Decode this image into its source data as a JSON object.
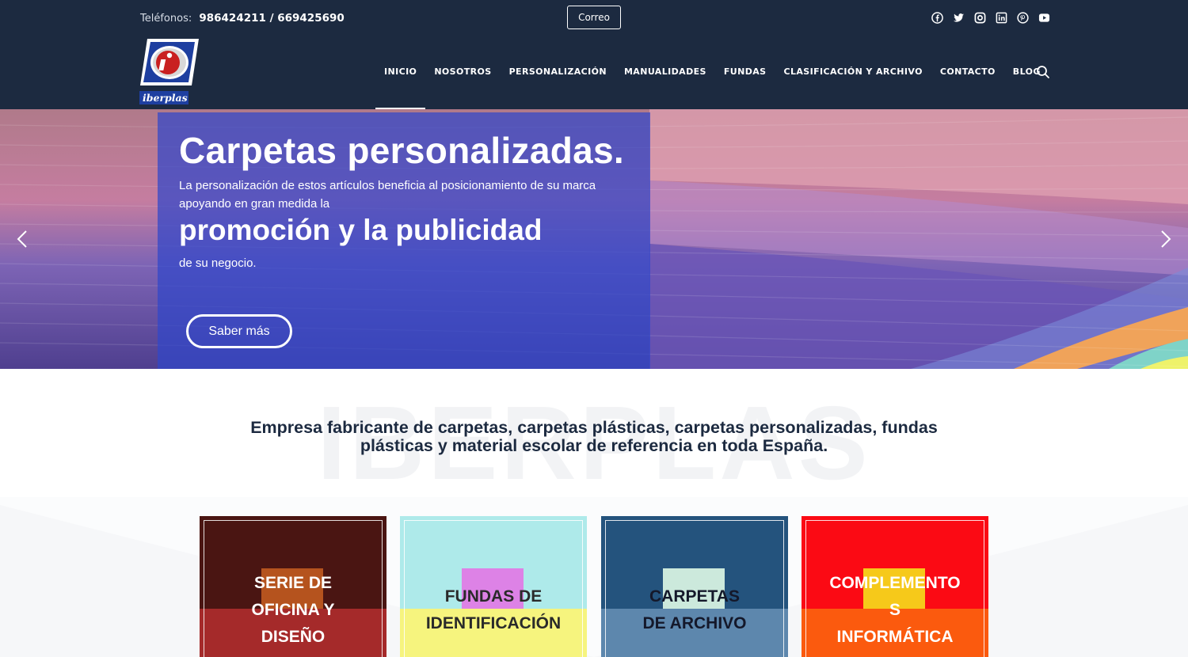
{
  "topbar": {
    "phones_label": "Teléfonos:",
    "phones_numbers": "986424211 / 669425690",
    "correo_label": "Correo",
    "social_icons": [
      "facebook-icon",
      "twitter-icon",
      "instagram-icon",
      "linkedin-icon",
      "pinterest-icon",
      "youtube-icon"
    ]
  },
  "logo": {
    "text": "iberplas"
  },
  "nav": {
    "items": [
      "INICIO",
      "NOSOTROS",
      "PERSONALIZACIÓN",
      "MANUALIDADES",
      "FUNDAS",
      "CLASIFICACIÓN Y ARCHIVO",
      "CONTACTO",
      "BLOG"
    ],
    "active_index": 0
  },
  "hero": {
    "title": "Carpetas personalizadas.",
    "line1": "La personalización de estos artículos beneficia al posicionamiento de su marca",
    "line2": "apoyando en gran medida la",
    "highlight": "promoción y la publicidad",
    "line3": "de su negocio.",
    "button_label": "Saber más"
  },
  "intro": {
    "watermark": "IBERPLAS",
    "heading_line1": "Empresa fabricante de carpetas, carpetas plásticas, carpetas personalizadas, fundas",
    "heading_line2": "plásticas y material escolar de referencia en toda España."
  },
  "cards": [
    {
      "line1": "SERIE DE",
      "line2": "OFICINA Y",
      "line3": "DISEÑO",
      "bg": "#4a1512",
      "band": "#a52a2a",
      "rect": "#b5531e",
      "color": "#ffffff"
    },
    {
      "line1": "",
      "line2": "FUNDAS DE",
      "line3": "IDENTIFICACIÓN",
      "bg": "#aeeaea",
      "band": "#f6f47e",
      "rect": "#dd82e6",
      "color": "#2a2a2a"
    },
    {
      "line1": "",
      "line2": "CARPETAS",
      "line3": "DE ARCHIVO",
      "bg": "#24537d",
      "band": "#5d87ad",
      "rect": "#cce9dc",
      "color": "#14182a"
    },
    {
      "line1": "COMPLEMENTO",
      "line2": "S",
      "line3": "INFORMÁTICA",
      "bg": "#fb0a14",
      "band": "#fb5a0e",
      "rect": "#f6c91a",
      "color": "#ffffff"
    }
  ]
}
